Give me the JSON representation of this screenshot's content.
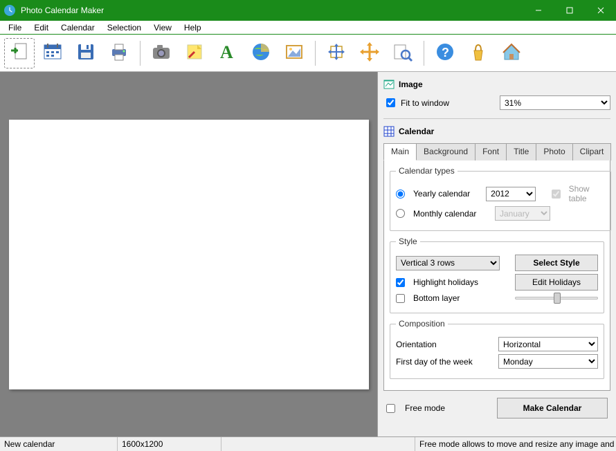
{
  "app": {
    "title": "Photo Calendar Maker"
  },
  "menu": [
    "File",
    "Edit",
    "Calendar",
    "Selection",
    "View",
    "Help"
  ],
  "toolbar_icons": [
    "new-doc-icon",
    "calendar-icon",
    "save-icon",
    "print-icon",
    "|",
    "camera-icon",
    "note-icon",
    "font-icon",
    "globe-icon",
    "picture-icon",
    "|",
    "expand-icon",
    "move-icon",
    "search-icon",
    "|",
    "help-icon",
    "shop-icon",
    "home-icon"
  ],
  "image_section": {
    "title": "Image",
    "fit_label": "Fit to window",
    "fit_checked": true,
    "zoom_value": "31%"
  },
  "calendar_section": {
    "title": "Calendar",
    "tabs": [
      "Main",
      "Background",
      "Font",
      "Title",
      "Photo",
      "Clipart"
    ],
    "active_tab": "Main",
    "types": {
      "legend": "Calendar types",
      "yearly_label": "Yearly calendar",
      "yearly_checked": true,
      "year_value": "2012",
      "show_table_label": "Show table",
      "show_table_checked": true,
      "monthly_label": "Monthly calendar",
      "monthly_checked": false,
      "month_value": "January"
    },
    "style": {
      "legend": "Style",
      "layout_value": "Vertical 3 rows",
      "select_style_btn": "Select Style",
      "highlight_label": "Highlight holidays",
      "highlight_checked": true,
      "edit_holidays_btn": "Edit Holidays",
      "bottom_layer_label": "Bottom layer",
      "bottom_layer_checked": false
    },
    "composition": {
      "legend": "Composition",
      "orientation_label": "Orientation",
      "orientation_value": "Horizontal",
      "firstday_label": "First day of the week",
      "firstday_value": "Monday"
    },
    "free_mode_label": "Free mode",
    "free_mode_checked": false,
    "make_btn": "Make Calendar"
  },
  "status": {
    "doc_name": "New calendar",
    "dimensions": "1600x1200",
    "hint": "Free mode allows to move and resize any image and te"
  }
}
